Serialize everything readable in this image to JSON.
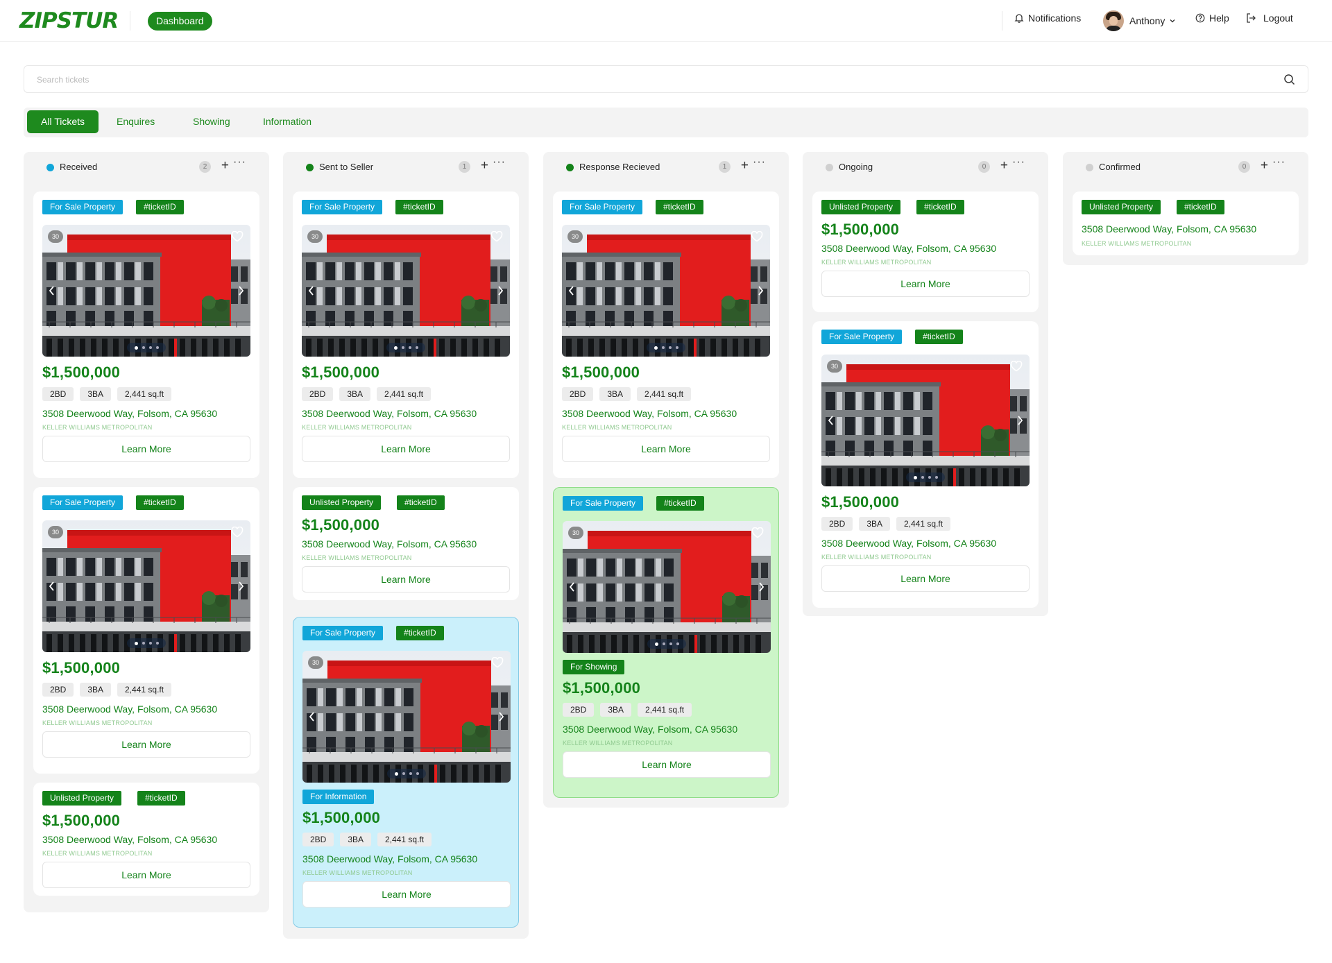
{
  "header": {
    "logo": "ZIPSTUR",
    "dashboard_label": "Dashboard",
    "notifications_label": "Notifications",
    "user_name": "Anthony",
    "help_label": "Help",
    "logout_label": "Logout"
  },
  "search": {
    "placeholder": "Search tickets"
  },
  "tabs": [
    "All Tickets",
    "Enquires",
    "Showing",
    "Information"
  ],
  "columns": [
    {
      "title": "Received",
      "count": "2",
      "dot_color": "#11a6d9"
    },
    {
      "title": "Sent to Seller",
      "count": "1",
      "dot_color": "#14831a"
    },
    {
      "title": "Response Recieved",
      "count": "1",
      "dot_color": "#14831a"
    },
    {
      "title": "Ongoing",
      "count": "0",
      "dot_color": "#d0d0d0"
    },
    {
      "title": "Confirmed",
      "count": "0",
      "dot_color": "#d0d0d0"
    }
  ],
  "card": {
    "for_sale_tag": "For Sale Property",
    "unlisted_tag": "Unlisted Property",
    "ticket_tag": "#ticketID",
    "photo_count": "30",
    "price": "$1,500,000",
    "beds": "2BD",
    "baths": "3BA",
    "area": "2,441 sq.ft",
    "address": "3508 Deerwood Way, Folsom, CA 95630",
    "agency": "KELLER WILLIAMS METROPOLITAN",
    "learn_more": "Learn More",
    "for_showing": "For Showing",
    "for_information": "For Information"
  },
  "colors": {
    "brand_green": "#14831a",
    "cyan": "#11a6d9",
    "showing_bg": "#ccf5c8",
    "info_bg": "#cbf0fb"
  }
}
